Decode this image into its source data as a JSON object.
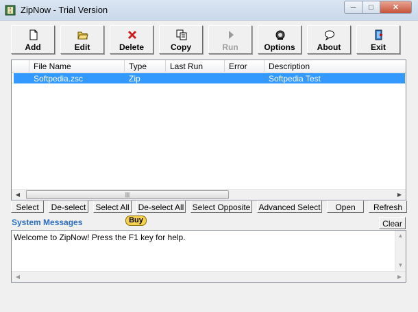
{
  "window": {
    "title": "ZipNow - Trial Version"
  },
  "toolbar": [
    {
      "label": "Add",
      "icon": "document-icon",
      "enabled": true
    },
    {
      "label": "Edit",
      "icon": "folder-open-icon",
      "enabled": true
    },
    {
      "label": "Delete",
      "icon": "delete-x-icon",
      "enabled": true
    },
    {
      "label": "Copy",
      "icon": "copy-icon",
      "enabled": true
    },
    {
      "label": "Run",
      "icon": "play-icon",
      "enabled": false
    },
    {
      "label": "Options",
      "icon": "options-icon",
      "enabled": true
    },
    {
      "label": "About",
      "icon": "speech-bubble-icon",
      "enabled": true
    },
    {
      "label": "Exit",
      "icon": "exit-door-icon",
      "enabled": true
    }
  ],
  "list": {
    "columns": [
      "File Name",
      "Type",
      "Last Run",
      "Error",
      "Description"
    ],
    "rows": [
      {
        "file_name": "Softpedia.zsc",
        "type": "Zip",
        "last_run": "",
        "error": "",
        "description": "Softpedia Test",
        "selected": true
      }
    ]
  },
  "selection_buttons": [
    "Select",
    "De-select",
    "Select All",
    "De-select All",
    "Select Opposite",
    "Advanced Select",
    "Open",
    "Refresh"
  ],
  "messages": {
    "label": "System Messages",
    "buy_label": "Buy",
    "clear_label": "Clear",
    "text": "Welcome to ZipNow! Press the F1 key for help."
  },
  "colors": {
    "selection": "#3399ff",
    "system_messages_label": "#2a6dbf",
    "buy_button": "#f5d14d",
    "delete_icon": "#cc1f1f"
  }
}
